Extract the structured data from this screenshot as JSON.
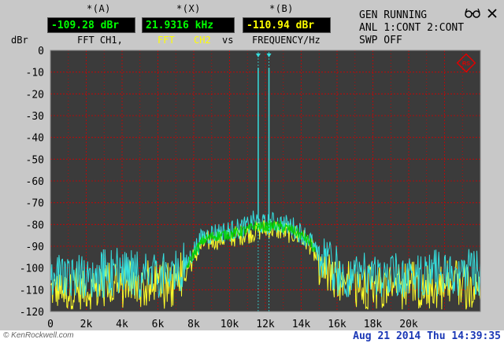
{
  "markers": {
    "a_label": "*(A)",
    "x_label": "*(X)",
    "b_label": "*(B)",
    "a_value": "-109.28 dBr",
    "x_value": "21.9316 kHz",
    "b_value": "-110.94 dBr"
  },
  "sub_labels": {
    "fft_ch1": "FFT  CH1,",
    "fft": "FFT",
    "ch2": "CH2",
    "vs": "vs",
    "frequency": "FREQUENCY/Hz"
  },
  "status": {
    "line1": "GEN RUNNING",
    "line2": "ANL 1:CONT 2:CONT",
    "line3": "SWP OFF"
  },
  "footer": {
    "watermark": "© KenRockwell.com",
    "timestamp": "Aug 21 2014 Thu 14:39:35"
  },
  "icons": {
    "status_icon": "glasses-icon",
    "close_icon": "close-icon",
    "brand_icon": "rohde-schwarz-logo-icon"
  },
  "colors": {
    "plot_bg": "#3b3b3b",
    "grid": "#d40000",
    "trace_ch1": "#35e0e0",
    "trace_ch2": "#ffff2a",
    "trace_mix": "#00d000",
    "readout_green": "#00ff00",
    "readout_yellow": "#ffff00",
    "timestamp": "#1a37b5"
  },
  "chart_data": {
    "type": "line",
    "ylabel": "dBr",
    "xlabel": "FREQUENCY/Hz",
    "xlim": [
      0,
      24000
    ],
    "ylim": [
      -120,
      0
    ],
    "grid": true,
    "x_ticks": [
      "0",
      "2k",
      "4k",
      "6k",
      "8k",
      "10k",
      "12k",
      "14k",
      "16k",
      "18k",
      "20k"
    ],
    "x_tick_values": [
      0,
      2000,
      4000,
      6000,
      8000,
      10000,
      12000,
      14000,
      16000,
      18000,
      20000
    ],
    "y_ticks": [
      "0",
      "-10",
      "-20",
      "-30",
      "-40",
      "-50",
      "-60",
      "-70",
      "-80",
      "-90",
      "-100",
      "-110",
      "-120"
    ],
    "y_tick_values": [
      0,
      -10,
      -20,
      -30,
      -40,
      -50,
      -60,
      -70,
      -80,
      -90,
      -100,
      -110,
      -120
    ],
    "series": [
      {
        "name": "CH1",
        "color": "#35e0e0",
        "x": [
          0,
          1000,
          2000,
          3000,
          4000,
          5000,
          6000,
          7000,
          7500,
          8000,
          8500,
          9000,
          10000,
          11000,
          11400,
          11600,
          11800,
          12000,
          12200,
          12500,
          13000,
          13500,
          14000,
          14500,
          15000,
          16000,
          17000,
          18000,
          19000,
          20000,
          21000,
          22000,
          23000,
          24000
        ],
        "y": [
          -105,
          -104,
          -105,
          -105,
          -104,
          -105,
          -105,
          -104,
          -100,
          -92,
          -86,
          -84,
          -83,
          -81,
          -78,
          -8,
          -80,
          -80,
          -8,
          -79,
          -80,
          -81,
          -84,
          -87,
          -96,
          -104,
          -105,
          -105,
          -104,
          -105,
          -105,
          -104,
          -105,
          -105
        ]
      },
      {
        "name": "CH2",
        "color": "#ffff2a",
        "x": [
          0,
          1000,
          2000,
          3000,
          4000,
          5000,
          6000,
          7000,
          7500,
          8000,
          8500,
          9000,
          10000,
          11000,
          12000,
          12500,
          13000,
          13500,
          14000,
          14500,
          15000,
          16000,
          17000,
          18000,
          19000,
          20000,
          21000,
          22000,
          23000,
          24000
        ],
        "y": [
          -110,
          -111,
          -110,
          -111,
          -110,
          -110,
          -111,
          -110,
          -103,
          -95,
          -89,
          -87,
          -86,
          -84,
          -82,
          -82,
          -83,
          -84,
          -86,
          -89,
          -99,
          -110,
          -111,
          -110,
          -111,
          -110,
          -111,
          -110,
          -110,
          -111
        ]
      }
    ],
    "markers": [
      {
        "name": "A",
        "x": 11600,
        "y": -109.28
      },
      {
        "name": "B",
        "x": 12200,
        "y": -110.94
      }
    ]
  }
}
